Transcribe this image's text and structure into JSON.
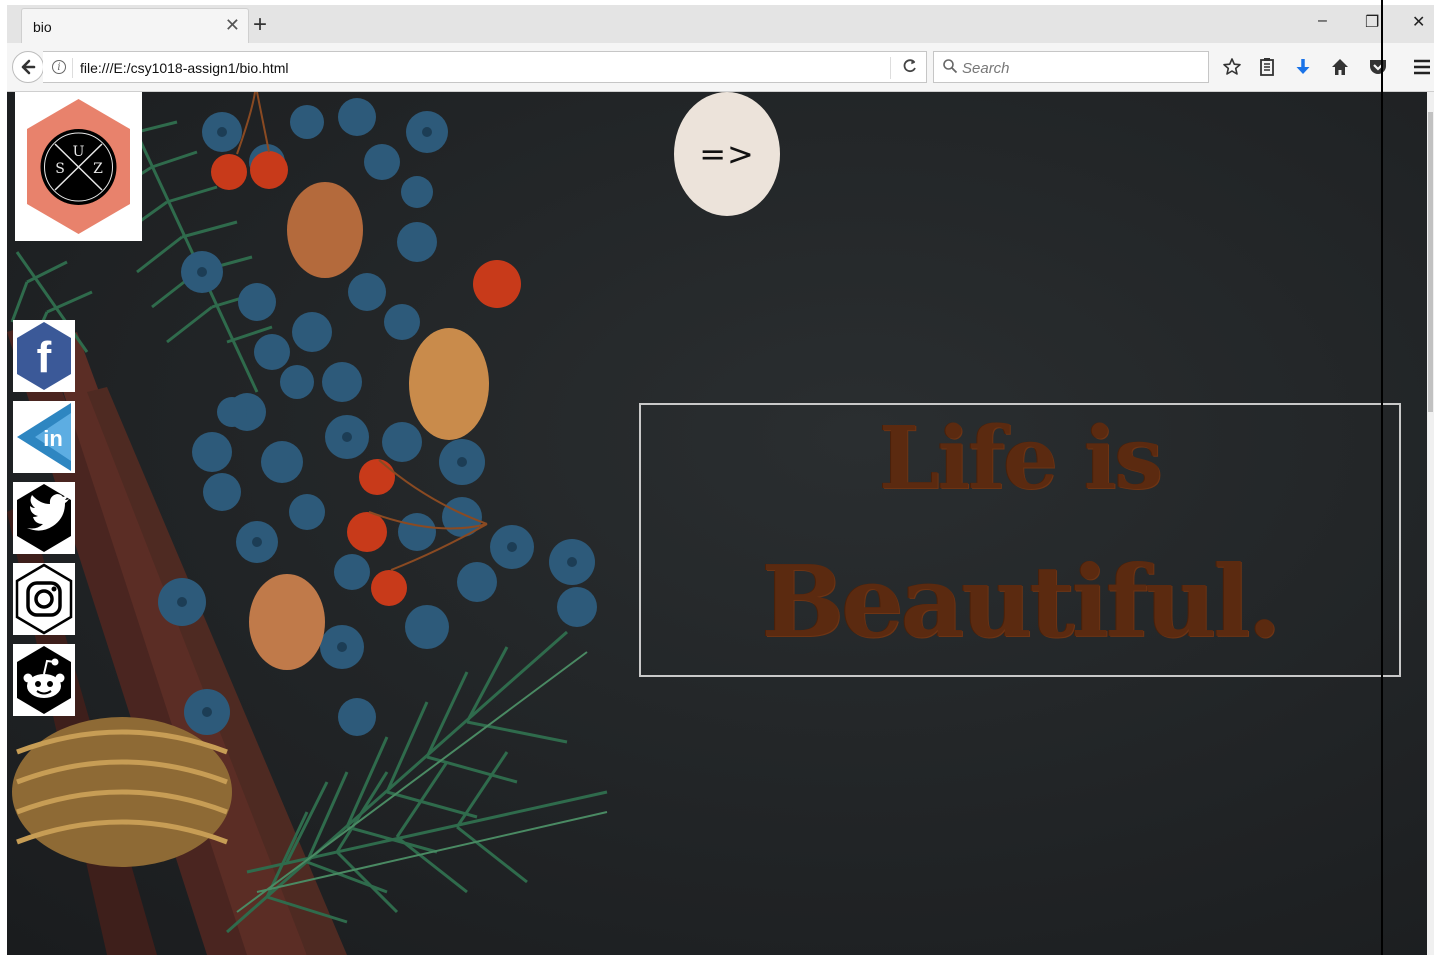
{
  "browser": {
    "tab_title": "bio",
    "tab_close": "✕",
    "new_tab": "+",
    "window_buttons": {
      "minimize": "–",
      "restore": "❐",
      "close": "✕"
    },
    "url": "file:///E:/csy1018-assign1/bio.html",
    "search_placeholder": "Search",
    "reload": "C"
  },
  "page": {
    "logo": {
      "top": "U",
      "left": "S",
      "right": "Z"
    },
    "arrow_button": "=>",
    "quote": {
      "line1": "Life is",
      "line2": "Beautiful."
    },
    "social": [
      {
        "name": "facebook",
        "icon": "facebook-icon",
        "color": "#3b5998",
        "glyph": "f"
      },
      {
        "name": "linkedin",
        "icon": "linkedin-icon",
        "color": "#2e86c1",
        "glyph": "in"
      },
      {
        "name": "twitter",
        "icon": "twitter-icon",
        "color": "#000000"
      },
      {
        "name": "instagram",
        "icon": "instagram-icon",
        "color": "#000000"
      },
      {
        "name": "reddit",
        "icon": "reddit-icon",
        "color": "#000000"
      }
    ],
    "colors": {
      "logo_hexagon": "#e8826c",
      "quote_text": "#5b2a10",
      "arrow_circle": "#ece3da"
    }
  }
}
